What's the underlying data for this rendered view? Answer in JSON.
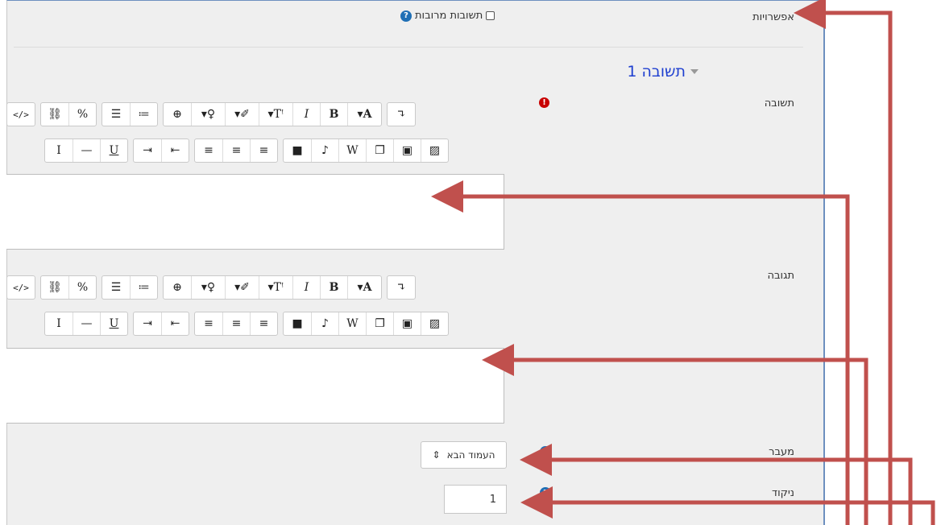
{
  "options": {
    "label": "אפשרויות",
    "multiple_answers_label": "תשובות מרובות"
  },
  "section": {
    "title": "תשובה 1"
  },
  "answer": {
    "label": "תשובה"
  },
  "response": {
    "label": "תגובה"
  },
  "jump": {
    "label": "מעבר",
    "selected": "העמוד הבא"
  },
  "score": {
    "label": "ניקוד",
    "value": "1"
  },
  "toolbar": {
    "row1": [
      [
        "code-icon"
      ],
      [
        "unlink-icon",
        "link-icon"
      ],
      [
        "ordered-list-icon",
        "bullet-list-icon"
      ],
      [
        "zoom-icon",
        "bulb-dropdown-icon",
        "brush-dropdown-icon",
        "font-size-dropdown-icon",
        "italic-icon",
        "bold-icon",
        "font-dropdown-icon"
      ],
      [
        "direction-icon"
      ]
    ],
    "row2": [
      [
        "clear-format-icon",
        "horizontal-rule-icon",
        "underline-icon"
      ],
      [
        "indent-icon",
        "outdent-icon"
      ],
      [
        "align-right-icon",
        "align-center-icon",
        "align-left-icon"
      ],
      [
        "video-icon",
        "microphone-icon",
        "word-paste-icon",
        "copy-icon",
        "media-icon",
        "image-icon"
      ]
    ]
  },
  "colors": {
    "arrow": "#c0504d",
    "panel_border": "#6d8fbf",
    "title": "#1e3fd0"
  }
}
